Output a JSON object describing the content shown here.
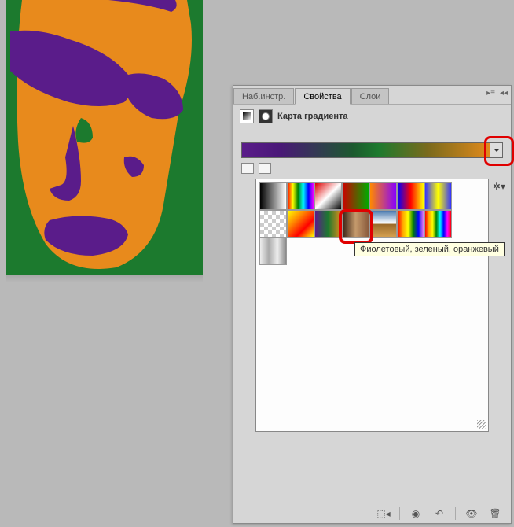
{
  "tabs": {
    "tools": "Наб.инстр.",
    "properties": "Свойства",
    "layers": "Слои"
  },
  "panel": {
    "title": "Карта градиента"
  },
  "tooltip": "Фиолетовый, зеленый, оранжевый",
  "gradients": [
    {
      "name": "black-white",
      "bg": "linear-gradient(90deg,#000,#fff)"
    },
    {
      "name": "spectrum",
      "bg": "linear-gradient(90deg,red,yellow,green,cyan,blue,magenta)"
    },
    {
      "name": "red-white-black",
      "bg": "linear-gradient(135deg,#d00,#fff 50%,#000)"
    },
    {
      "name": "red-green",
      "bg": "linear-gradient(90deg,#c00,#0a0)"
    },
    {
      "name": "orange-purple",
      "bg": "linear-gradient(90deg,#f80,#80f)"
    },
    {
      "name": "blue-red-yellow",
      "bg": "linear-gradient(90deg,#00f,#f00,#ff0)"
    },
    {
      "name": "blue-yellow-blue",
      "bg": "linear-gradient(90deg,#33f,#ff0,#33f)"
    },
    {
      "name": "transparency",
      "bg": "repeating-conic-gradient(#ccc 0 25%, #fff 0 50%) 0 0/10px 10px"
    },
    {
      "name": "yellow-orange-red",
      "bg": "linear-gradient(135deg,#ff0,#f80,#f00,#ff0)"
    },
    {
      "name": "purple-green-orange",
      "bg": "linear-gradient(90deg,#5a1c8a,#1c7a2e,#e08a1c)"
    },
    {
      "name": "copper",
      "bg": "linear-gradient(90deg,#3a2416,#c49a6c,#8a5a3c)"
    },
    {
      "name": "chrome",
      "bg": "linear-gradient(180deg,#4a7aaf 0%,#fff 48%,#9a6a2a 52%,#d4a050 100%)"
    },
    {
      "name": "rainbow-transparent",
      "bg": "linear-gradient(90deg,red,orange,yellow,green,blue,violet)"
    },
    {
      "name": "rainbow2",
      "bg": "linear-gradient(90deg,red,orange,yellow,green,cyan,blue,magenta,red)"
    },
    {
      "name": "stripes-fade",
      "bg": "linear-gradient(90deg,#eee,#aaa,#eee,#888)"
    }
  ]
}
